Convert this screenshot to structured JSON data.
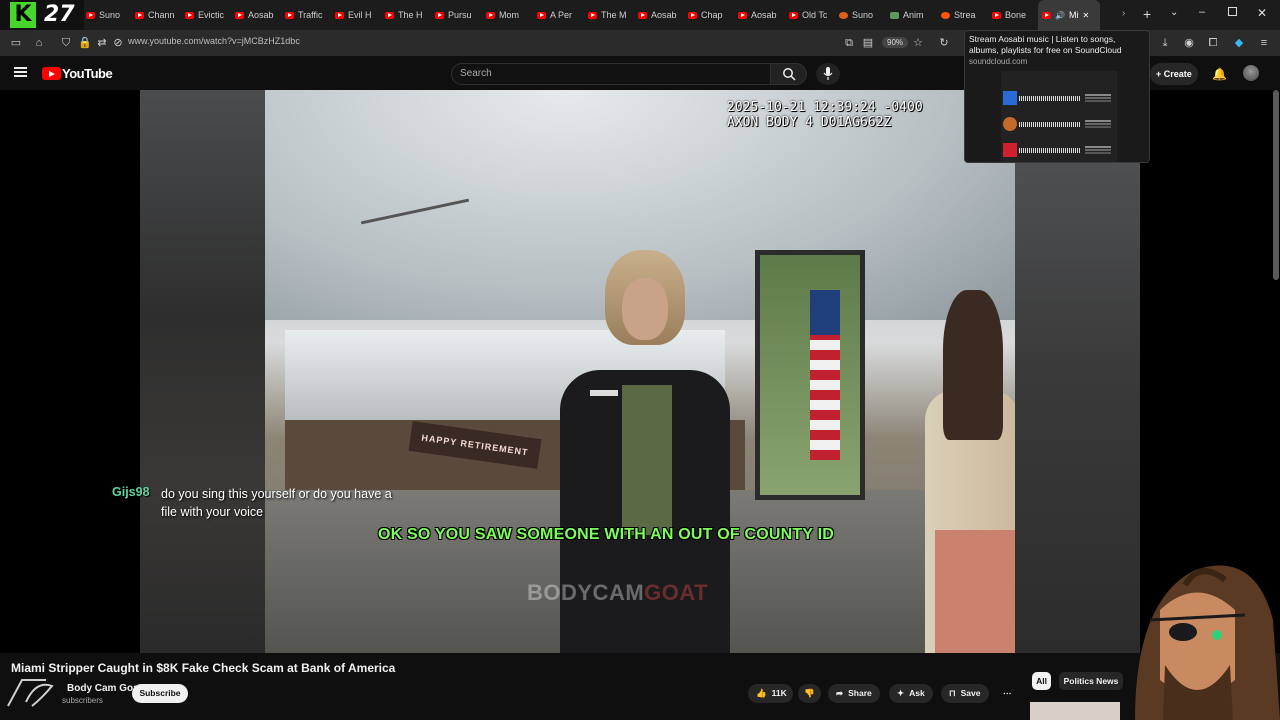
{
  "overlay_brand": {
    "letter": "K",
    "number": "27"
  },
  "tabs": [
    {
      "label": "Suno",
      "icon": "youtube-icon"
    },
    {
      "label": "Chann",
      "icon": "youtube-icon"
    },
    {
      "label": "Evictic",
      "icon": "youtube-icon"
    },
    {
      "label": "Aosab",
      "icon": "youtube-icon"
    },
    {
      "label": "Traffic",
      "icon": "youtube-icon"
    },
    {
      "label": "Evil H",
      "icon": "youtube-icon"
    },
    {
      "label": "The H",
      "icon": "youtube-icon"
    },
    {
      "label": "Pursu",
      "icon": "youtube-icon"
    },
    {
      "label": "Mom",
      "icon": "youtube-icon"
    },
    {
      "label": "A Per",
      "icon": "youtube-icon"
    },
    {
      "label": "The M",
      "icon": "youtube-icon"
    },
    {
      "label": "Aosab",
      "icon": "youtube-icon"
    },
    {
      "label": "Chap",
      "icon": "youtube-icon"
    },
    {
      "label": "Aosab",
      "icon": "youtube-icon"
    },
    {
      "label": "Old Tc",
      "icon": "youtube-icon"
    },
    {
      "label": "Suno",
      "icon": "suno-icon"
    },
    {
      "label": "Anim",
      "icon": "app-icon"
    },
    {
      "label": "Strea",
      "icon": "soundcloud-icon"
    },
    {
      "label": "Bone",
      "icon": "youtube-icon"
    },
    {
      "label": "Mi",
      "icon": "youtube-icon",
      "active": true
    }
  ],
  "address": {
    "url": "www.youtube.com/watch?v=jMCBzHZ1dbc",
    "zoom": "90%"
  },
  "tooltip": {
    "title": "Stream Aosabi music | Listen to songs, albums, playlists for free on SoundCloud",
    "domain": "soundcloud.com"
  },
  "youtube": {
    "logo_text": "YouTube",
    "search_placeholder": "Search",
    "create_label": "Create"
  },
  "video": {
    "cam_timestamp": "2025-10-21 12:39:24 -0400\nAXON BODY 4 D01AG662Z",
    "watermark_a": "BODYCAM",
    "watermark_b": "GOAT",
    "caption": "OK SO YOU SAW SOMEONE WITH AN OUT OF COUNTY ID",
    "banner_text": "HAPPY RETIREMENT",
    "chat": {
      "user": "Gijs98",
      "message": "do you sing this yourself or do you have a file with your voice"
    }
  },
  "below": {
    "title": "Miami Stripper Caught in $8K Fake Check Scam at Bank of America",
    "channel": "Body Cam Goat",
    "subs": "subscribers",
    "subscribe_label": "Subscribe",
    "like_count": "11K",
    "share_label": "Share",
    "ask_label": "Ask",
    "save_label": "Save",
    "chips": [
      "All",
      "Politics News"
    ]
  },
  "colors": {
    "caption": "#7dff5a",
    "chat_user": "#5fd3a0",
    "brand_green": "#46d62c",
    "youtube_red": "#ff0000"
  }
}
